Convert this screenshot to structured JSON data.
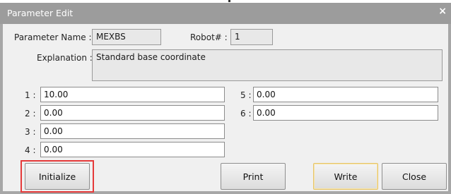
{
  "window": {
    "title": "Parameter Edit",
    "close_glyph": "×"
  },
  "header": {
    "param_name_label": "Parameter Name :",
    "param_name_value": "MEXBS",
    "robot_label": "Robot# :",
    "robot_value": "1",
    "explanation_label": "Explanation :",
    "explanation_value": "Standard base coordinate"
  },
  "fields": [
    {
      "label": "1 :",
      "value": "10.00"
    },
    {
      "label": "2 :",
      "value": "0.00"
    },
    {
      "label": "3 :",
      "value": "0.00"
    },
    {
      "label": "4 :",
      "value": "0.00"
    },
    {
      "label": "5 :",
      "value": "0.00"
    },
    {
      "label": "6 :",
      "value": "0.00"
    }
  ],
  "buttons": {
    "initialize": "Initialize",
    "print": "Print",
    "write": "Write",
    "close": "Close"
  },
  "colors": {
    "highlight": "#e53a3a",
    "write_border": "#e6c46a"
  }
}
